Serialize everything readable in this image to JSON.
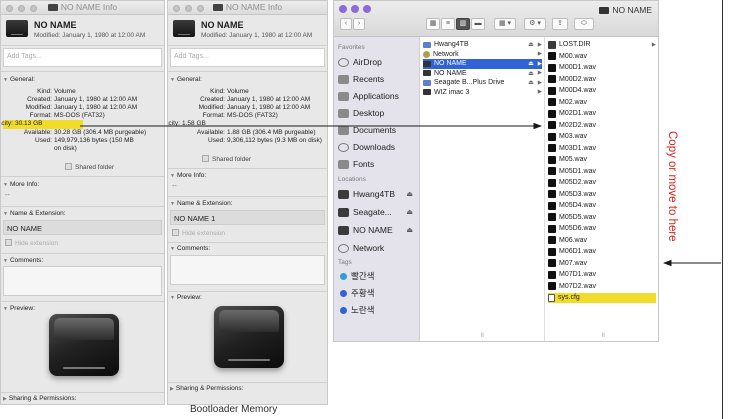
{
  "colors": {
    "highlight": "#f1dc2c",
    "selection": "#2f63d6",
    "annotation": "#d2261c",
    "window_bg": "#e8e8e8"
  },
  "info_left": {
    "window_title": "NO NAME Info",
    "name": "NO NAME",
    "modified": "Modified: January 1, 1980 at 12:00 AM",
    "tags_placeholder": "Add Tags...",
    "general_header": "General:",
    "fields": [
      {
        "k": "Kind:",
        "v": "Volume"
      },
      {
        "k": "Created:",
        "v": "January 1, 1980 at 12:00 AM"
      },
      {
        "k": "Modified:",
        "v": "January 1, 1980 at 12:00 AM"
      },
      {
        "k": "Format:",
        "v": "MS-DOS (FAT32)"
      },
      {
        "k": "Capacity:",
        "v": "30.13 GB"
      },
      {
        "k": "Available:",
        "v": "30.28 GB (306.4 MB purgeable)"
      },
      {
        "k": "Used:",
        "v": "149,979,136 bytes (150 MB"
      },
      {
        "k": "",
        "v": "on disk)"
      }
    ],
    "shared_folder": "Shared folder",
    "more_info_header": "More Info:",
    "more_info_value": "--",
    "name_ext_header": "Name & Extension:",
    "name_value": "NO NAME",
    "hide_extension": "Hide extension",
    "comments_header": "Comments:",
    "preview_header": "Preview:",
    "sharing_header": "Sharing & Permissions:"
  },
  "info_right": {
    "window_title": "NO NAME Info",
    "name": "NO NAME",
    "modified": "Modified: January 1, 1980 at 12:00 AM",
    "tags_placeholder": "Add Tags...",
    "general_header": "General:",
    "fields": [
      {
        "k": "Kind:",
        "v": "Volume"
      },
      {
        "k": "Created:",
        "v": "January 1, 1980 at 12:00 AM"
      },
      {
        "k": "Modified:",
        "v": "January 1, 1980 at 12:00 AM"
      },
      {
        "k": "Format:",
        "v": "MS-DOS (FAT32)"
      },
      {
        "k": "Capacity:",
        "v": "1.58 GB"
      },
      {
        "k": "Available:",
        "v": "1.88 GB (306.4 MB purgeable)"
      },
      {
        "k": "Used:",
        "v": "9,306,112 bytes (9.3 MB on disk)"
      }
    ],
    "shared_folder": "Shared folder",
    "more_info_header": "More Info:",
    "more_info_value": "--",
    "name_ext_header": "Name & Extension:",
    "name_value": "NO NAME 1",
    "hide_extension": "Hide extension",
    "comments_header": "Comments:",
    "preview_header": "Preview:",
    "sharing_header": "Sharing & Permissions:"
  },
  "finder": {
    "title": "NO NAME",
    "favorites_header": "Favorites",
    "favorites": [
      "AirDrop",
      "Recents",
      "Applications",
      "Desktop",
      "Documents",
      "Downloads",
      "Fonts"
    ],
    "locations_header": "Locations",
    "locations": [
      "Hwang4TB",
      "Seagate...",
      "NO NAME",
      "Network"
    ],
    "tags_header": "Tags",
    "tags": [
      {
        "label": "빨간색",
        "color": "#2a9fd8"
      },
      {
        "label": "주황색",
        "color": "#2f63d6"
      },
      {
        "label": "노란색",
        "color": "#2f63d6"
      }
    ],
    "column1": [
      "Hwang4TB",
      "Network",
      "NO NAME",
      "NO NAME",
      "Seagate B...Plus Drive",
      "WIZ imac 3"
    ],
    "column2": [
      "LOST.DIR",
      "M00.wav",
      "M00D1.wav",
      "M00D2.wav",
      "M00D4.wav",
      "M02.wav",
      "M02D1.wav",
      "M02D2.wav",
      "M03.wav",
      "M03D1.wav",
      "M05.wav",
      "M05D1.wav",
      "M05D2.wav",
      "M05D3.wav",
      "M05D4.wav",
      "M05D5.wav",
      "M05D6.wav",
      "M06.wav",
      "M06D1.wav",
      "M07.wav",
      "M07D1.wav",
      "M07D2.wav",
      "sys.cfg"
    ]
  },
  "caption": "Bootloader Memory",
  "side_label": "Copy or move to here"
}
